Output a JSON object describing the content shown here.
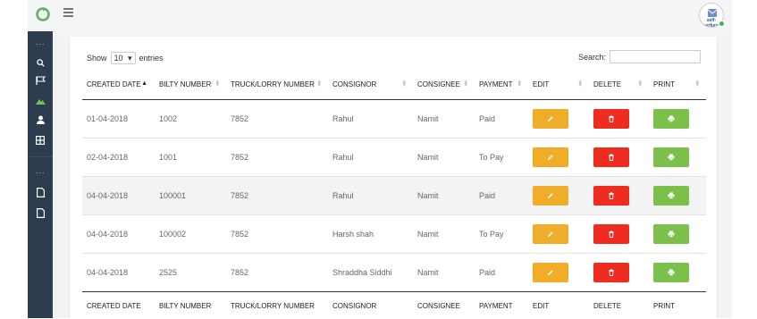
{
  "header": {
    "avatar_text": "self-serfund"
  },
  "sidebar": {
    "items": [
      {
        "icon": "dots-icon"
      },
      {
        "icon": "search-icon"
      },
      {
        "icon": "flag-icon"
      },
      {
        "icon": "mountain-icon"
      },
      {
        "icon": "user-icon"
      },
      {
        "icon": "plus-square-icon"
      },
      {
        "icon": "dots-icon"
      },
      {
        "icon": "file-icon"
      },
      {
        "icon": "file-icon"
      }
    ]
  },
  "toolbar": {
    "show_label": "Show",
    "entries_value": "10",
    "entries_label": "entries",
    "search_label": "Search:",
    "search_value": ""
  },
  "table": {
    "columns": [
      "CREATED DATE",
      "BILTY NUMBER",
      "TRUCK/LORRY NUMBER",
      "CONSIGNOR",
      "CONSIGNEE",
      "PAYMENT",
      "EDIT",
      "DELETE",
      "PRINT"
    ],
    "rows": [
      {
        "created_date": "01-04-2018",
        "bilty_number": "1002",
        "truck_number": "7852",
        "consignor": "Rahul",
        "consignee": "Namit",
        "payment": "Paid"
      },
      {
        "created_date": "02-04-2018",
        "bilty_number": "1001",
        "truck_number": "7852",
        "consignor": "Rahul",
        "consignee": "Namit",
        "payment": "To Pay"
      },
      {
        "created_date": "04-04-2018",
        "bilty_number": "100001",
        "truck_number": "7852",
        "consignor": "Rahul",
        "consignee": "Namit",
        "payment": "Paid"
      },
      {
        "created_date": "04-04-2018",
        "bilty_number": "100002",
        "truck_number": "7852",
        "consignor": "Harsh shah",
        "consignee": "Namit",
        "payment": "To Pay"
      },
      {
        "created_date": "04-04-2018",
        "bilty_number": "2525",
        "truck_number": "7852",
        "consignor": "Shraddha Siddhi",
        "consignee": "Namit",
        "payment": "Paid"
      }
    ]
  },
  "colors": {
    "sidebar": "#2b3d4f",
    "edit": "#f0ad2a",
    "delete": "#ee2c20",
    "print": "#7bc04a"
  }
}
